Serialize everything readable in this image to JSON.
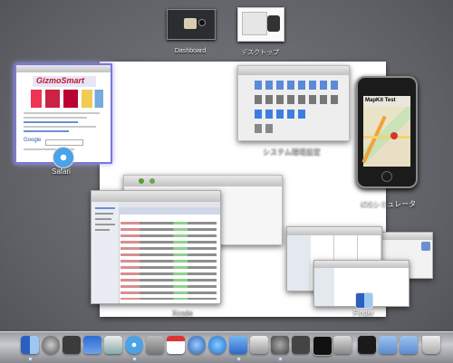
{
  "spaces": [
    {
      "label": "Dashboard"
    },
    {
      "label": "デスクトップ"
    }
  ],
  "windows": {
    "safari": {
      "label": "Safari",
      "site_title": "GizmoSmart",
      "search_text": "Google"
    },
    "system_prefs": {
      "label": "システム環境設定"
    },
    "ios_simulator": {
      "label": "iOSシミュレータ",
      "screen_title": "MapKit Test"
    },
    "xcode": {
      "label": "Xcode"
    },
    "finder": {
      "label": "Finder"
    }
  },
  "dock": {
    "items": [
      "finder",
      "launchpad",
      "dashboard",
      "mission-control",
      "preview",
      "safari",
      "mail",
      "ical",
      "itunes",
      "appstore",
      "xcode",
      "instruments",
      "pencil",
      "system-prefs",
      "x11",
      "terminal",
      "utility",
      "activity-monitor",
      "folder",
      "downloads",
      "trash"
    ],
    "running_indicators": [
      "finder",
      "safari",
      "xcode",
      "system-prefs"
    ]
  },
  "colors": {
    "background": "#6b6d72",
    "safari_purple": "#7a78d8",
    "accent_blue": "#6a8fd6"
  }
}
